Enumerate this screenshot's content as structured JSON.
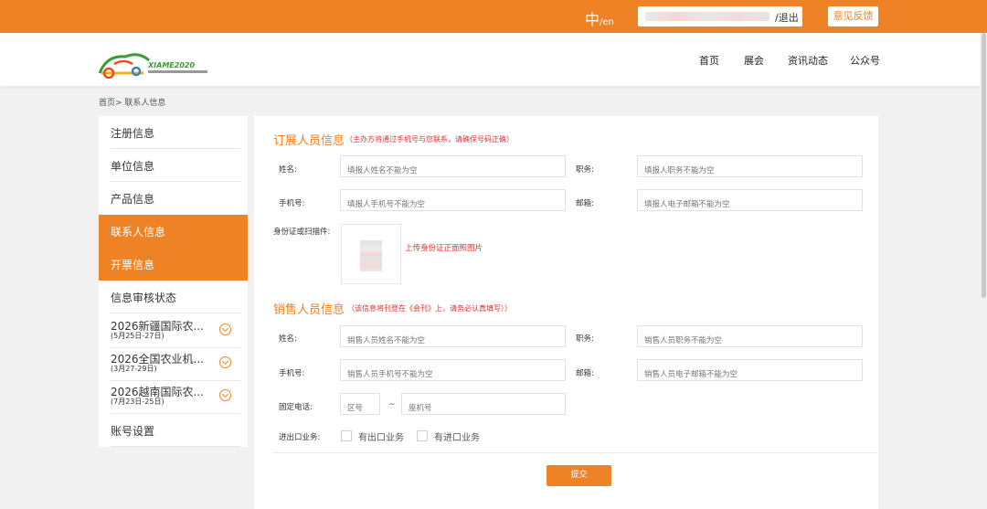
{
  "topbar": {
    "lang_zh": "中",
    "lang_en": "/en",
    "logout": "/退出",
    "feedback": "意见反馈"
  },
  "header": {
    "logo_text": "XIAME2020",
    "nav": [
      "首页",
      "展会",
      "资讯动态",
      "公众号"
    ]
  },
  "breadcrumb": "首页> 联系人信息",
  "sidebar": {
    "items": [
      "注册信息",
      "单位信息",
      "产品信息",
      "联系人信息",
      "开票信息",
      "信息审核状态"
    ],
    "expos": [
      {
        "title": "2026新疆国际农...",
        "dates": "(5月25日-27日)"
      },
      {
        "title": "2026全国农业机...",
        "dates": "(3月27-29日)"
      },
      {
        "title": "2026越南国际农...",
        "dates": "(7月23日-25日)"
      }
    ],
    "account": "账号设置"
  },
  "booking": {
    "title": "订展人员信息",
    "note": "（主办方将通过手机号与您联系，请确保号码正确）",
    "name_label": "姓名:",
    "name_placeholder": "填报人姓名不能为空",
    "position_label": "职务:",
    "position_placeholder": "填报人职务不能为空",
    "phone_label": "手机号:",
    "phone_placeholder": "填报人手机号不能为空",
    "email_label": "邮箱:",
    "email_placeholder": "填报人电子邮箱不能为空",
    "id_label": "身份证或扫描件:",
    "upload_text": "上传身份证正面照图片"
  },
  "sales": {
    "title": "销售人员信息",
    "note": "（该信息将刊登在《会刊》上，请务必认真填写））",
    "name_label": "姓名:",
    "name_placeholder": "销售人员姓名不能为空",
    "position_label": "职务:",
    "position_placeholder": "销售人员职务不能为空",
    "phone_label": "手机号:",
    "phone_placeholder": "销售人员手机号不能为空",
    "email_label": "邮箱:",
    "email_placeholder": "销售人员电子邮箱不能为空",
    "tel_label": "固定电话:",
    "area_placeholder": "区号",
    "tilde": "~",
    "landline_placeholder": "座机号",
    "trade_label": "进出口业务:",
    "export_label": "有出口业务",
    "import_label": "有进口业务"
  },
  "submit": "提交",
  "colors": {
    "accent": "#ef8224",
    "warning": "#e0322f"
  }
}
